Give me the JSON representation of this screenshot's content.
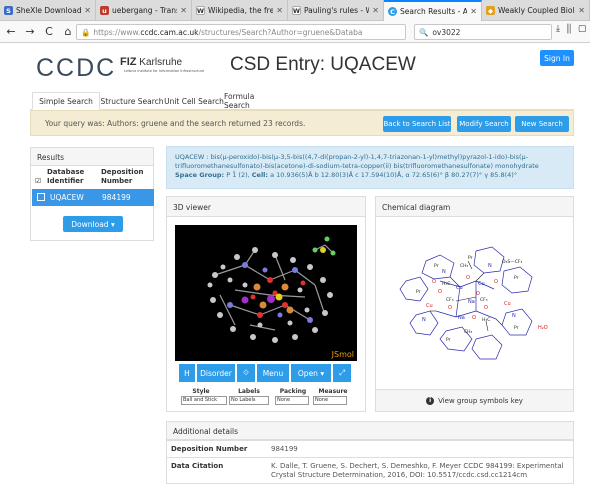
{
  "browser": {
    "tabs": [
      {
        "label": "SheXle Download Page",
        "color": "#3d6bc9",
        "glyph": "S"
      },
      {
        "label": "uebergang - Translatio",
        "color": "#c0392b",
        "glyph": "u"
      },
      {
        "label": "Wikipedia, the free enc",
        "color": "#888888",
        "glyph": "W"
      },
      {
        "label": "Pauling's rules - Wikipe",
        "color": "#888888",
        "glyph": "W"
      },
      {
        "label": "Search Results - Access",
        "color": "#2d9de9",
        "glyph": "C"
      },
      {
        "label": "Weakly Coupled Biolog",
        "color": "#e0a020",
        "glyph": "◆"
      }
    ],
    "url_prefix": "https://www.",
    "url_domain": "ccdc.cam.ac.uk",
    "url_rest": "/structures/Search?Author=gruene&Databa",
    "search_value": "ov3022",
    "nav": {
      "back": "←",
      "forward": "→",
      "reload": "C",
      "home": "⌂"
    },
    "right_icons": "⤓ ⫼ ▢"
  },
  "header": {
    "logo": "CCDC",
    "fiz_brand": "FIZ",
    "fiz_name": "Karlsruhe",
    "fiz_sub": "Leibniz Institute for Information Infrastructure",
    "title": "CSD Entry: UQACEW",
    "signin": "Sign In"
  },
  "search_tabs": [
    "Simple Search",
    "Structure Search",
    "Unit Cell Search",
    "Formula Search"
  ],
  "query": {
    "text": "Your query was: Authors: gruene and the search returned 23 records.",
    "buttons": [
      "Back to Search List",
      "Modify Search",
      "New Search"
    ]
  },
  "results": {
    "title": "Results",
    "col1": "Database Identifier",
    "col2": "Deposition Number",
    "row": {
      "id": "UQACEW",
      "number": "984199"
    },
    "download": "Download ▾"
  },
  "entry": {
    "line1": "UQACEW : bis(μ-peroxido)-bis(μ-3,5-bis((4,7-di(propan-2-yl)-1,4,7-triazonan-1-yl)methyl)pyrazol-1-ido)-bis(μ-",
    "line2": "trifluoromethanesulfonato)-bis(acetone)-di-sodium-tetra-copper(ii) bis(trifluoromethanesulfonate) monohydrate",
    "spacegroup_label": "Space Group:",
    "spacegroup_value": "P 1̄ (2),",
    "cell_label": "Cell:",
    "cell_value": "a 10.936(5)Å b 12.80(3)Å c 17.594(10)Å, α 72.65(6)° β 80.27(7)° γ 85.8(4)°"
  },
  "viewer": {
    "title": "3D viewer",
    "jsmol": "JSmol",
    "buttons": [
      "H",
      "Disorder",
      "⟐",
      "Menu",
      "Open ▾",
      "⤢"
    ],
    "controls": [
      {
        "label": "Style",
        "value": "Ball and Stick"
      },
      {
        "label": "Labels",
        "value": "No Labels"
      },
      {
        "label": "Packing",
        "value": "None"
      },
      {
        "label": "Measure",
        "value": "None"
      }
    ]
  },
  "chem": {
    "title": "Chemical diagram",
    "footer": "View group symbols key",
    "labels": {
      "triflate": "O₃S—CF₃",
      "water": "H₂O"
    }
  },
  "details": {
    "title": "Additional details",
    "rows": [
      {
        "key": "Deposition Number",
        "value": "984199"
      },
      {
        "key": "Data Citation",
        "value": "K. Dalle, T. Gruene, S. Dechert, S. Demeshko, F. Meyer CCDC 984199: Experimental Crystal Structure Determination, 2016, DOI: 10.5517/ccdc.csd.cc1214cm"
      }
    ]
  },
  "colors": {
    "accent": "#2d9de9",
    "selected_row": "#3a96e6",
    "query_bg": "#f4ecd3",
    "info_bg": "#d8eaf6"
  }
}
